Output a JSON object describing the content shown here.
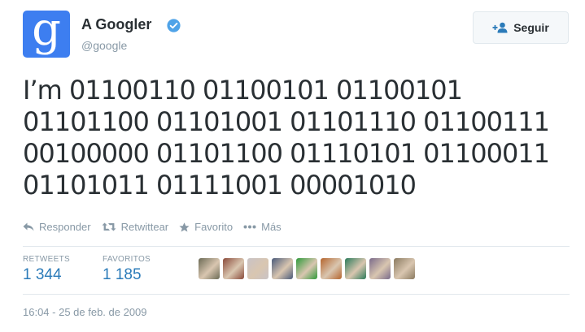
{
  "author": {
    "name": "A Googler",
    "handle": "@google",
    "avatar_letter": "g",
    "avatar_color": "#3d7ef0",
    "verified": true
  },
  "follow_button": {
    "label": "Seguir",
    "icon": "follow-person-icon"
  },
  "tweet": {
    "text": "I’m 01100110 01100101 01100101 01101100 01101001 01101110 01100111 00100000 01101100 01110101 01100011 01101011 01111001 00001010"
  },
  "actions": [
    {
      "label": "Responder",
      "icon": "reply-icon"
    },
    {
      "label": "Retwittear",
      "icon": "retweet-icon"
    },
    {
      "label": "Favorito",
      "icon": "star-icon"
    },
    {
      "label": "Más",
      "icon": "more-dots-icon"
    }
  ],
  "stats": {
    "retweets_label": "RETWEETS",
    "retweets_count": "1 344",
    "favorites_label": "FAVORITOS",
    "favorites_count": "1 185"
  },
  "faces": [
    {
      "name": "user-avatar-1",
      "color": "#6b6a55"
    },
    {
      "name": "user-avatar-2",
      "color": "#8a4a3a"
    },
    {
      "name": "user-avatar-3",
      "color": "#c9c3c6"
    },
    {
      "name": "user-avatar-4",
      "color": "#4a5a7a"
    },
    {
      "name": "user-avatar-5",
      "color": "#2f9a3a"
    },
    {
      "name": "user-avatar-6",
      "color": "#b5652e"
    },
    {
      "name": "user-avatar-7",
      "color": "#2a7a5a"
    },
    {
      "name": "user-avatar-8",
      "color": "#7a6a8a"
    },
    {
      "name": "user-avatar-9",
      "color": "#8a7a60"
    }
  ],
  "timestamp": "16:04 - 25 de feb. de 2009",
  "colors": {
    "link_blue": "#2b7bb9",
    "verified_blue": "#4fa3e8",
    "muted": "#8899a6"
  }
}
